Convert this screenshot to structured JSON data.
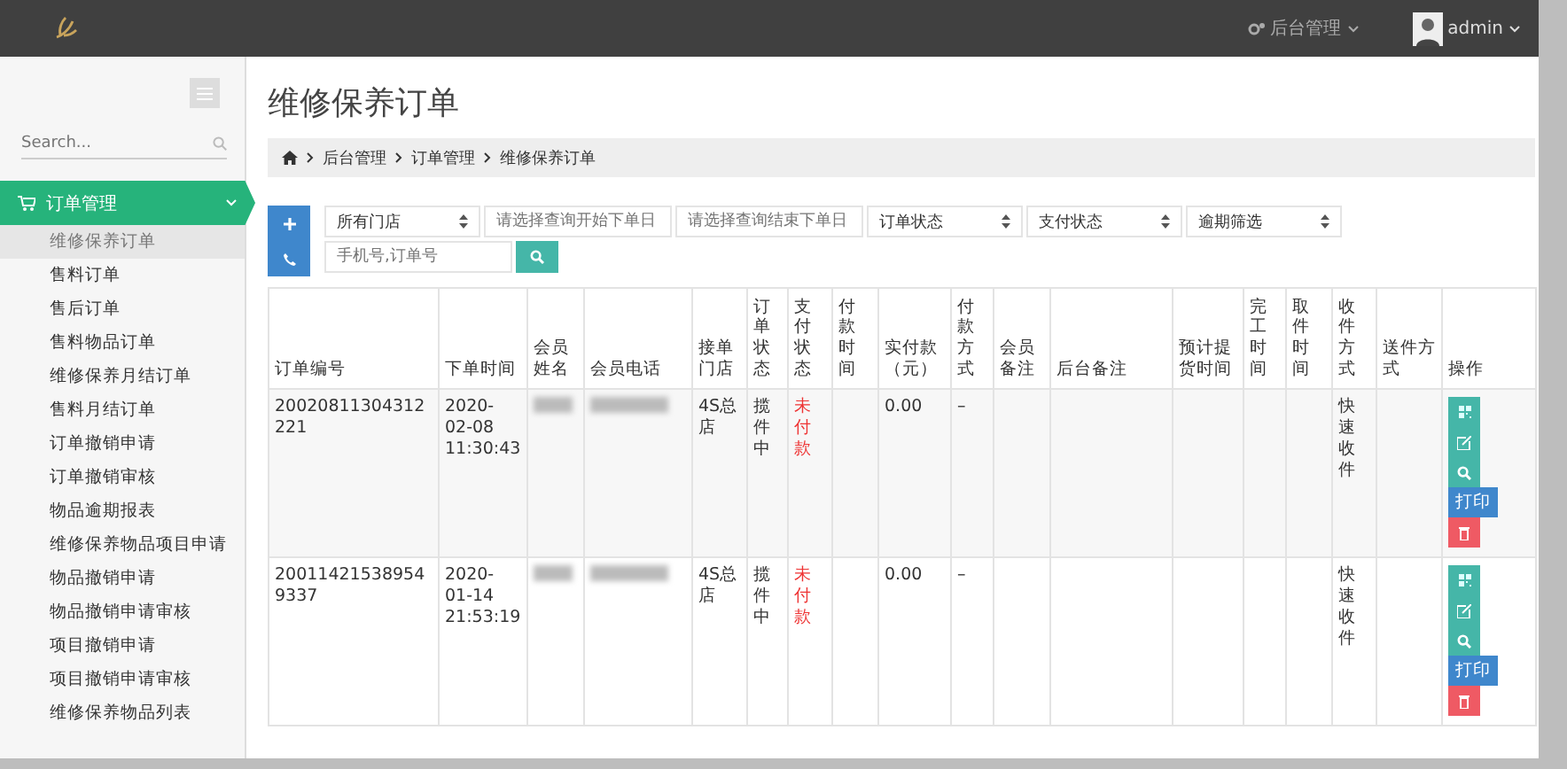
{
  "topbar": {
    "menu": "后台管理",
    "user": "admin"
  },
  "sidebar": {
    "search_placeholder": "Search...",
    "group": {
      "label": "订单管理",
      "expanded": true
    },
    "items": [
      {
        "label": "维修保养订单",
        "selected": true
      },
      {
        "label": "售料订单",
        "selected": false
      },
      {
        "label": "售后订单",
        "selected": false
      },
      {
        "label": "售料物品订单",
        "selected": false
      },
      {
        "label": "维修保养月结订单",
        "selected": false
      },
      {
        "label": "售料月结订单",
        "selected": false
      },
      {
        "label": "订单撤销申请",
        "selected": false
      },
      {
        "label": "订单撤销审核",
        "selected": false
      },
      {
        "label": "物品逾期报表",
        "selected": false
      },
      {
        "label": "维修保养物品项目申请",
        "selected": false
      },
      {
        "label": "物品撤销申请",
        "selected": false
      },
      {
        "label": "物品撤销申请审核",
        "selected": false
      },
      {
        "label": "项目撤销申请",
        "selected": false
      },
      {
        "label": "项目撤销申请审核",
        "selected": false
      },
      {
        "label": "维修保养物品列表",
        "selected": false
      }
    ]
  },
  "page_title": "维修保养订单",
  "breadcrumb": [
    "后台管理",
    "订单管理",
    "维修保养订单"
  ],
  "filters": {
    "store": "所有门店",
    "start_date_placeholder": "请选择查询开始下单日",
    "end_date_placeholder": "请选择查询结束下单日",
    "order_status": "订单状态",
    "pay_status": "支付状态",
    "overdue": "逾期筛选",
    "search_placeholder": "手机号,订单号"
  },
  "table": {
    "columns": [
      "订单编号",
      "下单时间",
      "会员姓名",
      "会员电话",
      "接单门店",
      "订单状态",
      "支付状态",
      "付款时间",
      "实付款（元）",
      "付款方式",
      "会员备注",
      "后台备注",
      "预计提货时间",
      "完工时间",
      "取件时间",
      "收件方式",
      "送件方式",
      "操作"
    ],
    "rows": [
      {
        "order_no": "20020811304312221",
        "time": "2020-02-08 11:30:43",
        "store": "4S总店",
        "status": "揽件中",
        "pay_status": "未付款",
        "unpaid": true,
        "amount": "0.00",
        "pay_method": "–",
        "receive": "快速收件",
        "print": "打印"
      },
      {
        "order_no": "200114215389549337",
        "time": "2020-01-14 21:53:19",
        "store": "4S总店",
        "status": "揽件中",
        "pay_status": "未付款",
        "unpaid": true,
        "amount": "0.00",
        "pay_method": "–",
        "receive": "快速收件",
        "print": "打印"
      }
    ]
  }
}
